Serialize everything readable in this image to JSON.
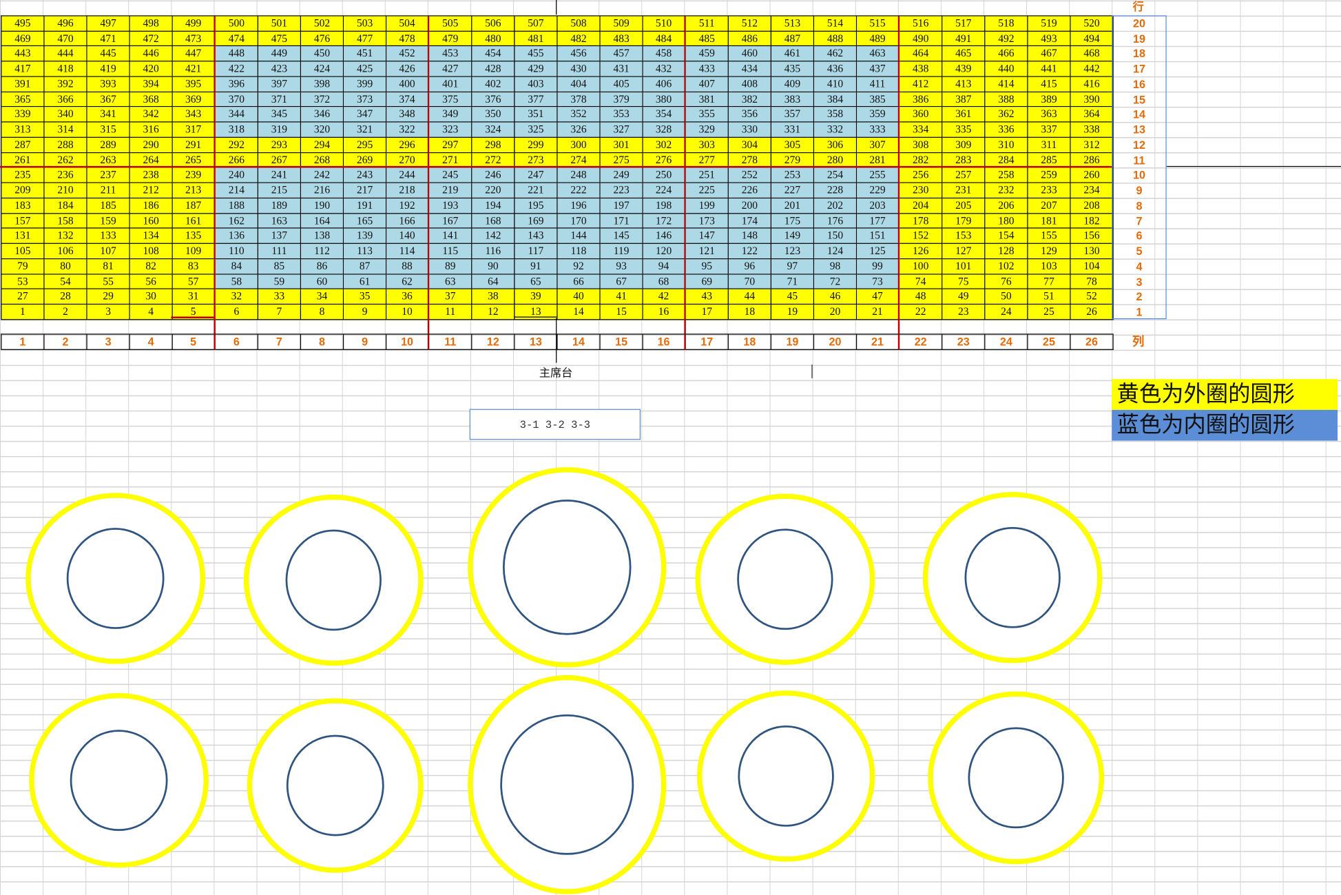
{
  "seat_grid": {
    "columns": 26,
    "rows": 20,
    "row_header_label": "行",
    "column_footer_label": "列",
    "row_numbers": [
      "20",
      "19",
      "18",
      "17",
      "16",
      "15",
      "14",
      "13",
      "12",
      "11",
      "10",
      "9",
      "8",
      "7",
      "6",
      "5",
      "4",
      "3",
      "2",
      "1"
    ],
    "column_numbers": [
      "1",
      "2",
      "3",
      "4",
      "5",
      "6",
      "7",
      "8",
      "9",
      "10",
      "11",
      "12",
      "13",
      "14",
      "15",
      "16",
      "17",
      "18",
      "19",
      "20",
      "21",
      "22",
      "23",
      "24",
      "25",
      "26"
    ],
    "seats_start_bottom_left": 1,
    "numbering": "row-major from row 1 (bottom) left to right",
    "colors": {
      "outer_yellow": "#ffff00",
      "inner_blue": "#add8e6",
      "group_divider": "#c00000",
      "header_text": "#e36c09"
    },
    "yellow_rows": [
      1,
      2,
      11,
      12,
      17,
      18,
      19,
      20
    ],
    "yellow_edge_columns": [
      1,
      2,
      3,
      4,
      5,
      22,
      23,
      24,
      25,
      26
    ],
    "all_yellow_rows": [
      1,
      2,
      11,
      12,
      19,
      20
    ],
    "divider_after_columns": [
      5,
      10,
      16,
      21
    ],
    "divider_after_row_from_bottom": 10
  },
  "stage_label": "主席台",
  "group_box_text": "3-1 3-2 3-3",
  "legend": {
    "yellow_text": "黄色为外圈的圆形",
    "blue_text": "蓝色为内圈的圆形",
    "yellow_color": "#ffff00",
    "blue_color": "#5b8ed6"
  },
  "tables": {
    "outer_ring_color": "#ffff00",
    "inner_ring_color": "#2f5480",
    "count": 10
  }
}
